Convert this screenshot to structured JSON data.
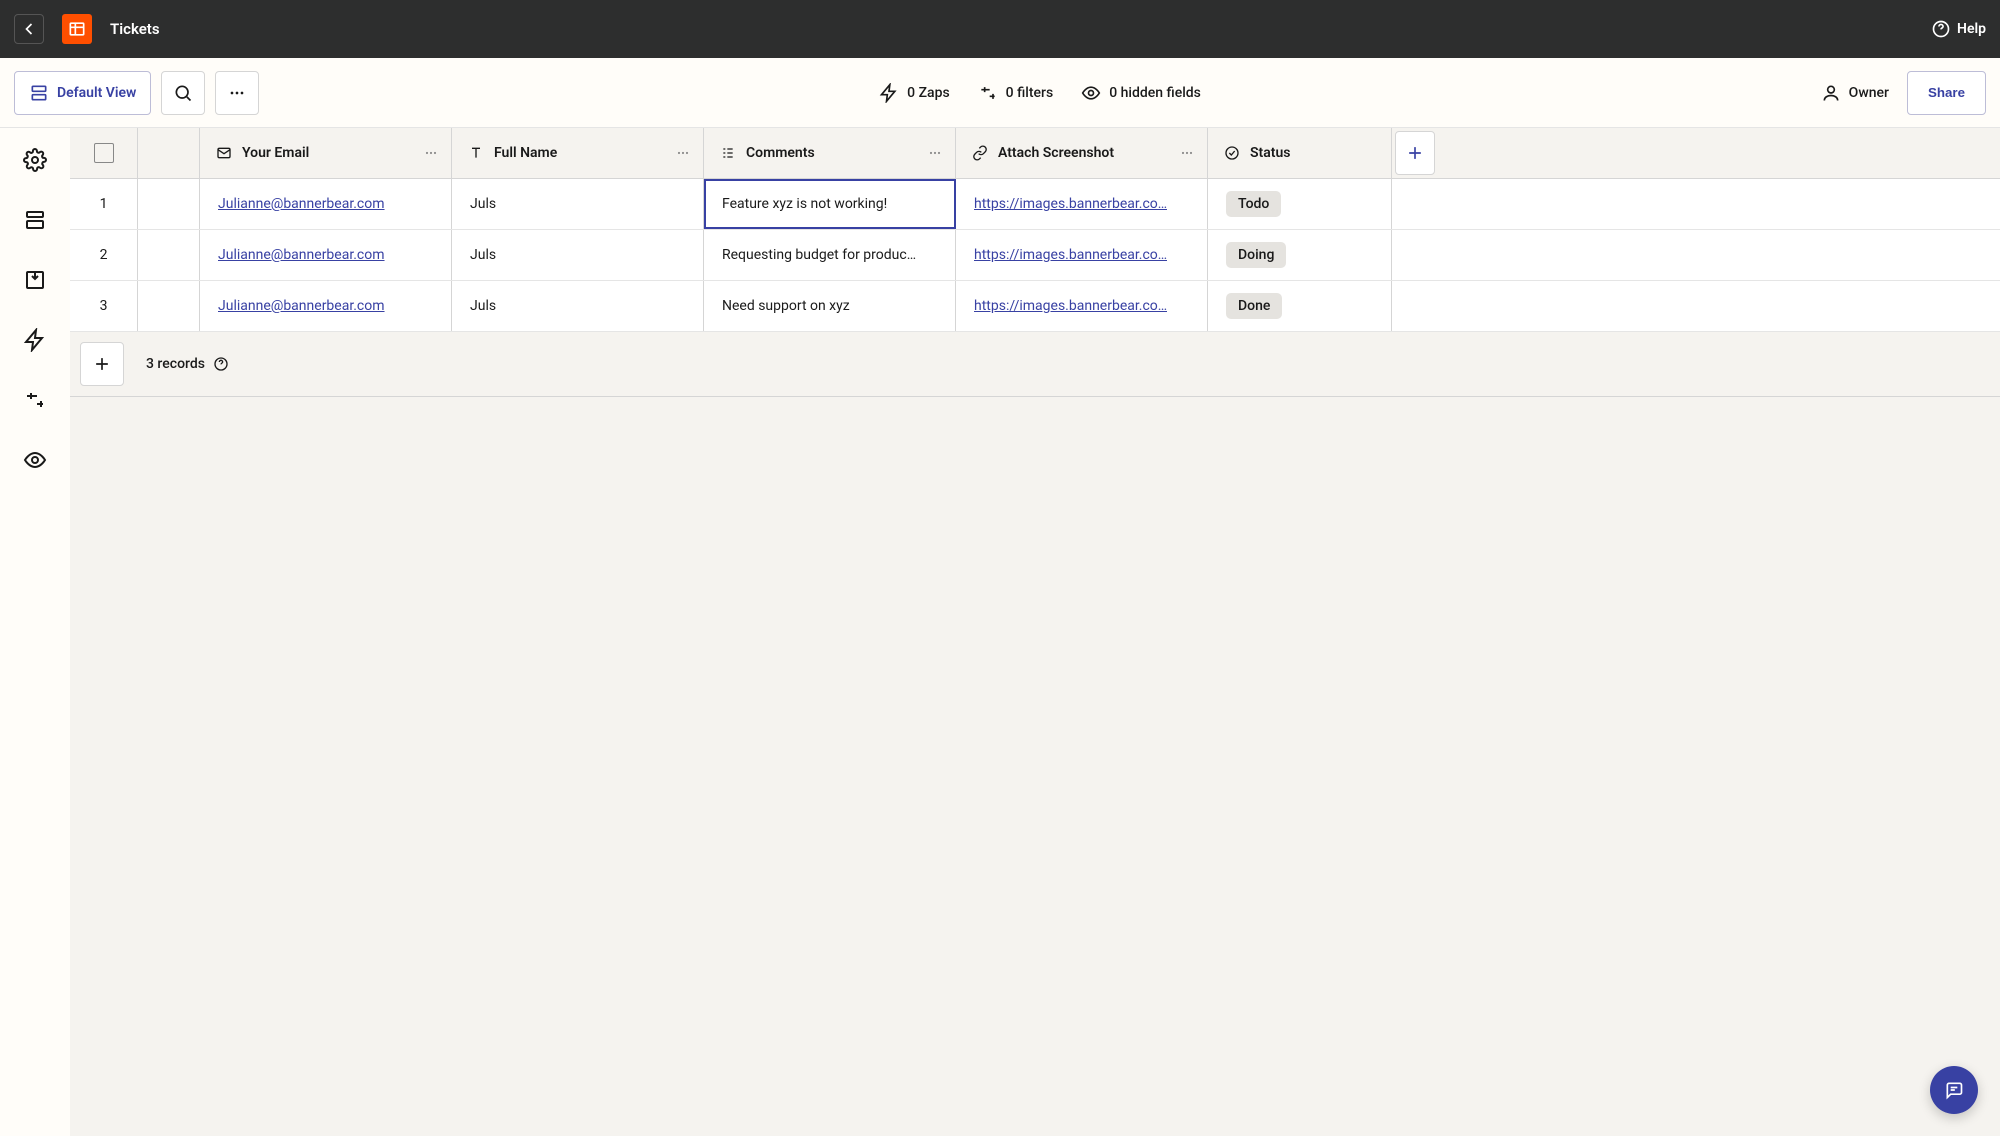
{
  "header": {
    "title": "Tickets",
    "help_label": "Help"
  },
  "toolbar": {
    "default_view_label": "Default View",
    "zaps_label": "0 Zaps",
    "filters_label": "0 filters",
    "hidden_fields_label": "0 hidden fields",
    "owner_label": "Owner",
    "share_label": "Share"
  },
  "columns": {
    "email": "Your Email",
    "full_name": "Full Name",
    "comments": "Comments",
    "attach": "Attach Screenshot",
    "status": "Status"
  },
  "rows": [
    {
      "num": "1",
      "email": "Julianne@bannerbear.com",
      "full_name": "Juls",
      "comments": "Feature xyz is not working!",
      "attach": "https://images.bannerbear.co…",
      "status": "Todo"
    },
    {
      "num": "2",
      "email": "Julianne@bannerbear.com",
      "full_name": "Juls",
      "comments": "Requesting budget for produc…",
      "attach": "https://images.bannerbear.co…",
      "status": "Doing"
    },
    {
      "num": "3",
      "email": "Julianne@bannerbear.com",
      "full_name": "Juls",
      "comments": "Need support on xyz",
      "attach": "https://images.bannerbear.co…",
      "status": "Done"
    }
  ],
  "footer": {
    "records_label": "3 records"
  },
  "selected_cell": {
    "row": 0,
    "col": "comments"
  }
}
